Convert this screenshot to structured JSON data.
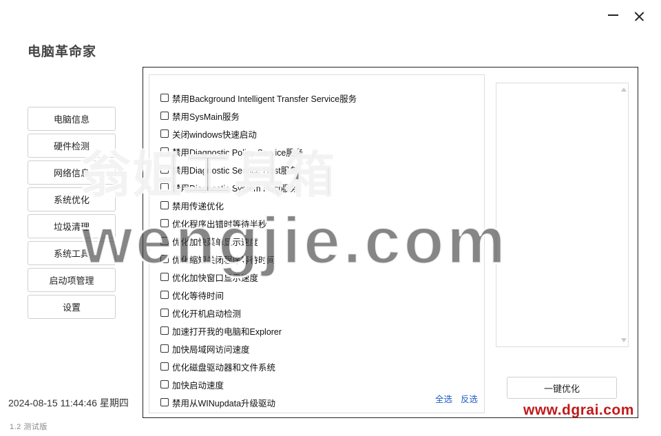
{
  "app": {
    "title": "电脑革命家",
    "version": "1.2  测试版",
    "datetime": "2024-08-15 11:44:46  星期四"
  },
  "nav": {
    "items": [
      {
        "label": "电脑信息"
      },
      {
        "label": "硬件检测"
      },
      {
        "label": "网络信息"
      },
      {
        "label": "系统优化"
      },
      {
        "label": "垃圾清理"
      },
      {
        "label": "系统工具"
      },
      {
        "label": "启动项管理"
      },
      {
        "label": "设置"
      }
    ]
  },
  "options": {
    "items": [
      {
        "label": "禁用Background Intelligent Transfer Service服务"
      },
      {
        "label": "禁用SysMain服务"
      },
      {
        "label": "关闭windows快速启动"
      },
      {
        "label": "禁用Diagnostic Policy Service服务"
      },
      {
        "label": "禁用Diagnostic Service Host服务"
      },
      {
        "label": "禁用Diagnostic System Host服务"
      },
      {
        "label": "禁用传递优化"
      },
      {
        "label": "优化程序出错时等待半秒"
      },
      {
        "label": "优化加快菜单显示速度"
      },
      {
        "label": "优化缩短关闭程序等待时间"
      },
      {
        "label": "优化加快窗口显示速度"
      },
      {
        "label": "优化等待时间"
      },
      {
        "label": "优化开机启动检测"
      },
      {
        "label": "加速打开我的电脑和Explorer"
      },
      {
        "label": "加快局域网访问速度"
      },
      {
        "label": "优化磁盘驱动器和文件系统"
      },
      {
        "label": "加快启动速度"
      },
      {
        "label": "禁用从WINupdata升级驱动"
      }
    ],
    "select_all": "全选",
    "invert": "反选"
  },
  "actions": {
    "one_key": "一键优化"
  },
  "watermark": {
    "cn": "翁姐工具箱",
    "en": "wengjie.com",
    "url": "www.dgrai.com"
  },
  "icons": {
    "minimize": "minimize-icon",
    "close": "close-icon"
  }
}
